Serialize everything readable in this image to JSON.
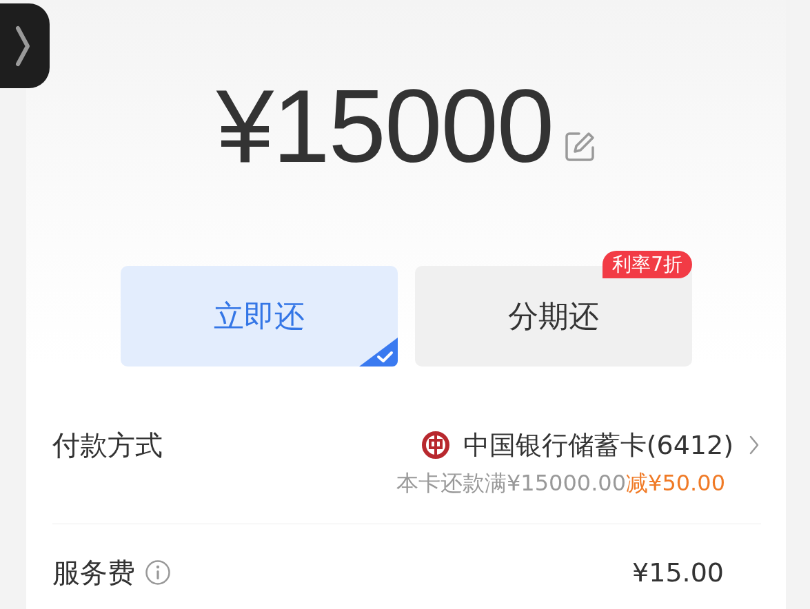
{
  "amount": "¥15000",
  "options": [
    {
      "label": "立即还",
      "selected": true
    },
    {
      "label": "分期还",
      "selected": false,
      "badge": "利率7折"
    }
  ],
  "payment": {
    "label": "付款方式",
    "card": "中国银行储蓄卡(6412)",
    "promo": "本卡还款满¥15000.00",
    "discount": "减¥50.00"
  },
  "fee": {
    "label": "服务费",
    "value": "¥15.00"
  }
}
